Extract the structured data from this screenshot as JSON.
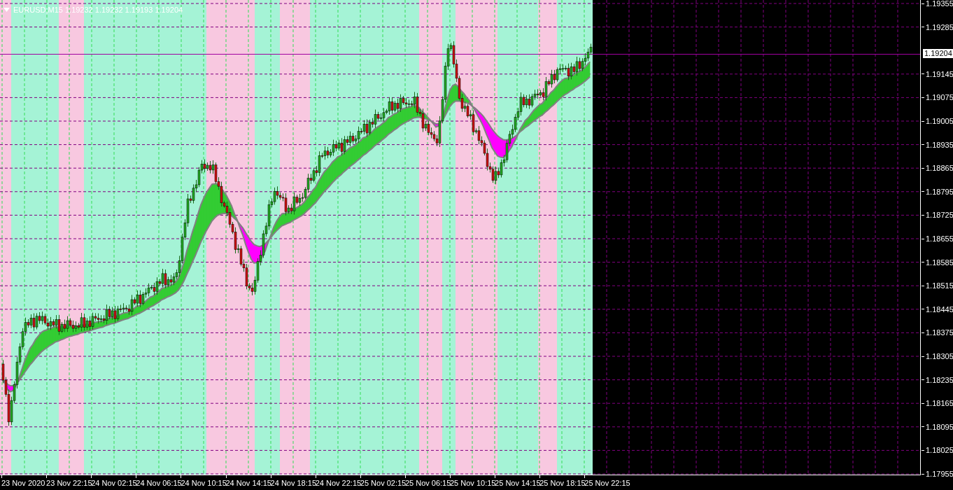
{
  "chart_header": {
    "symbol": "EURUSD,M15",
    "quotes": [
      "1.19232",
      "1.19232",
      "1.19193",
      "1.19204"
    ]
  },
  "price_axis": [
    "1.19355",
    "1.19285",
    "1.19145",
    "1.19075",
    "1.19005",
    "1.18935",
    "1.18865",
    "1.18795",
    "1.18725",
    "1.18655",
    "1.18585",
    "1.18515",
    "1.18445",
    "1.18375",
    "1.18305",
    "1.18235",
    "1.18165",
    "1.18095",
    "1.18025",
    "1.17955"
  ],
  "current_price": "1.19204",
  "time_axis": [
    "23 Nov 2020",
    "23 Nov 22:15",
    "24 Nov 02:15",
    "24 Nov 06:15",
    "24 Nov 10:15",
    "24 Nov 14:15",
    "24 Nov 18:15",
    "24 Nov 22:15",
    "25 Nov 02:15",
    "25 Nov 06:15",
    "25 Nov 10:15",
    "25 Nov 14:15",
    "25 Nov 18:15",
    "25 Nov 22:15"
  ]
}
